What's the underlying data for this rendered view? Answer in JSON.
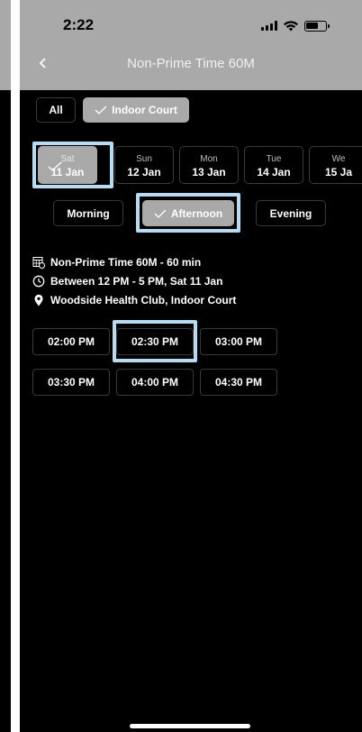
{
  "status_bar": {
    "time": "2:22"
  },
  "header": {
    "title": "Non-Prime Time 60M",
    "back_icon": "chevron-left-icon"
  },
  "filters": [
    {
      "label": "All",
      "selected": false
    },
    {
      "label": "Indoor Court",
      "selected": true
    }
  ],
  "days": [
    {
      "dow": "Sat",
      "date": "11 Jan",
      "selected": true
    },
    {
      "dow": "Sun",
      "date": "12 Jan",
      "selected": false
    },
    {
      "dow": "Mon",
      "date": "13 Jan",
      "selected": false
    },
    {
      "dow": "Tue",
      "date": "14 Jan",
      "selected": false
    },
    {
      "dow": "We",
      "date": "15 Ja",
      "selected": false
    }
  ],
  "periods": [
    {
      "label": "Morning",
      "selected": false
    },
    {
      "label": "Afternoon",
      "selected": true
    },
    {
      "label": "Evening",
      "selected": false
    }
  ],
  "details": {
    "service": "Non-Prime Time 60M - 60 min",
    "time_range": "Between 12 PM - 5 PM, Sat 11 Jan",
    "location": "Woodside Health Club, Indoor Court"
  },
  "time_slots": [
    {
      "label": "02:00 PM"
    },
    {
      "label": "02:30 PM",
      "highlighted": true
    },
    {
      "label": "03:00 PM"
    },
    {
      "label": "03:30 PM"
    },
    {
      "label": "04:00 PM"
    },
    {
      "label": "04:30 PM"
    }
  ],
  "colors": {
    "background": "#000000",
    "header": "#a9a9a9",
    "selected": "#a9a9a9",
    "highlight": "#b7dbf3",
    "chip_border": "#3a3a3a"
  }
}
